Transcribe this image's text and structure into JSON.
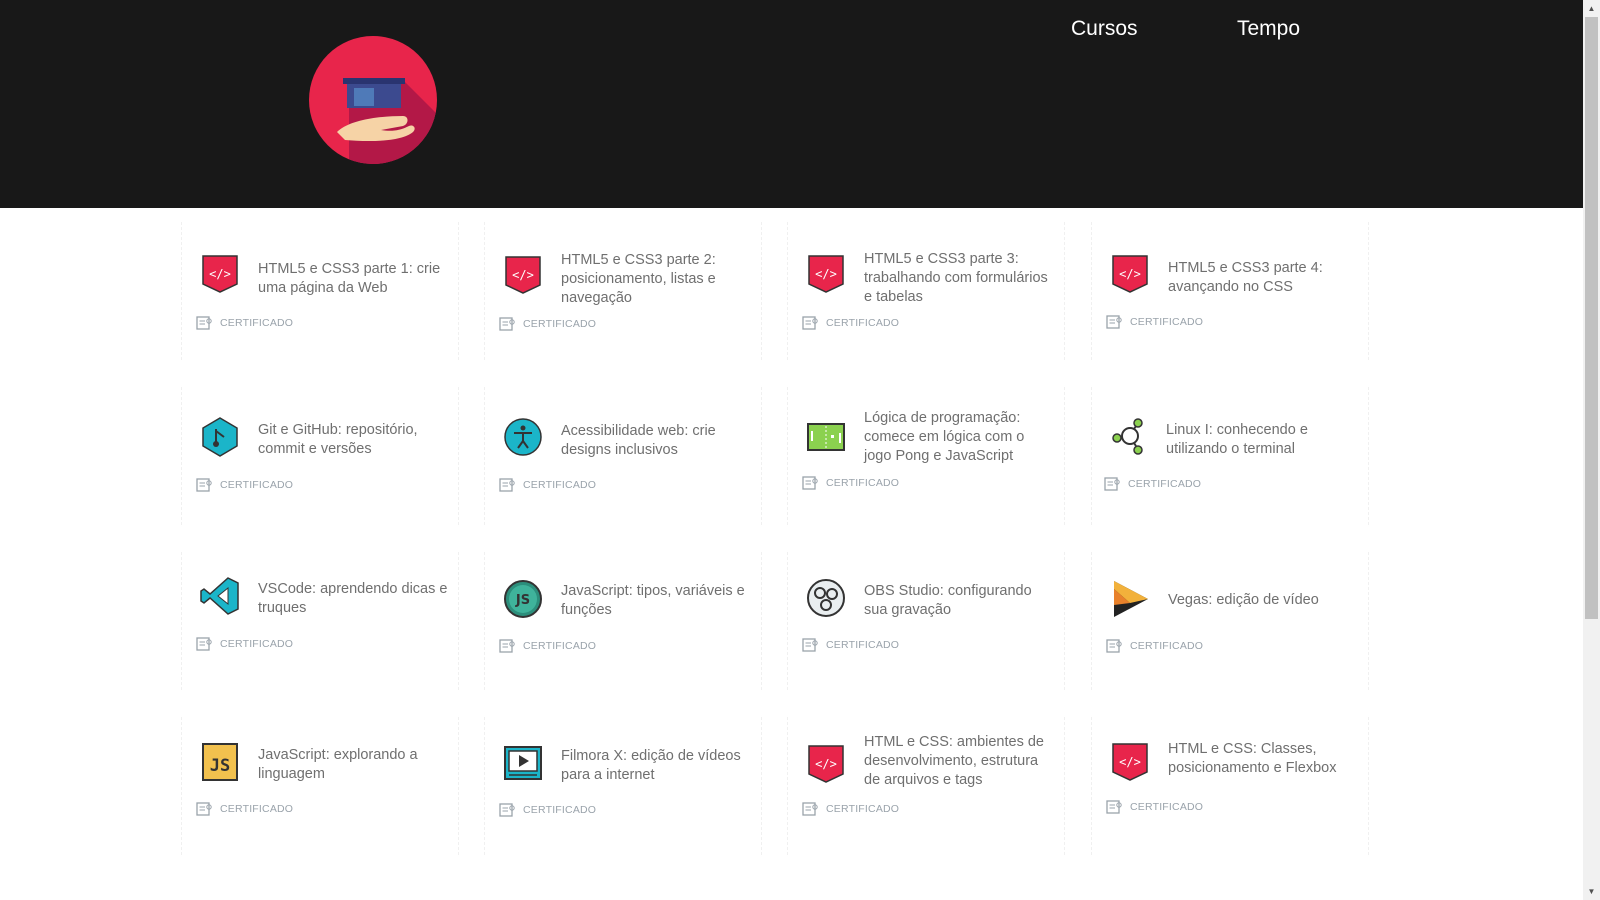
{
  "nav": {
    "cursos": "Cursos",
    "tempo": "Tempo"
  },
  "colors": {
    "header_bg": "#181818",
    "logo_bg": "#e8254b",
    "html_icon": "#e8254b",
    "text": "#6f6f6f",
    "cert": "#9aa3ab"
  },
  "cert_label": "CERTIFICADO",
  "courses": [
    {
      "title": "HTML5 e CSS3 parte 1: crie uma página da Web",
      "icon": "html-icon"
    },
    {
      "title": "HTML5 e CSS3 parte 2: posicionamento, listas e navegação",
      "icon": "html-icon"
    },
    {
      "title": "HTML5 e CSS3 parte 3: trabalhando com formulários e tabelas",
      "icon": "html-icon"
    },
    {
      "title": "HTML5 e CSS3 parte 4: avançando no CSS",
      "icon": "html-icon"
    },
    {
      "title": "Git e GitHub: repositório, commit e versões",
      "icon": "git-icon"
    },
    {
      "title": "Acessibilidade web: crie designs inclusivos",
      "icon": "accessibility-icon"
    },
    {
      "title": "Lógica de programação: comece em lógica com o jogo Pong e JavaScript",
      "icon": "pong-icon"
    },
    {
      "title": "Linux I: conhecendo e utilizando o terminal",
      "icon": "linux-icon"
    },
    {
      "title": "VSCode: aprendendo dicas e truques",
      "icon": "vscode-icon"
    },
    {
      "title": "JavaScript: tipos, variáveis e funções",
      "icon": "js-circle-icon"
    },
    {
      "title": "OBS Studio: configurando sua gravação",
      "icon": "obs-icon"
    },
    {
      "title": "Vegas: edição de vídeo",
      "icon": "vegas-icon"
    },
    {
      "title": "JavaScript: explorando a linguagem",
      "icon": "js-square-icon"
    },
    {
      "title": "Filmora X: edição de vídeos para a internet",
      "icon": "filmora-icon"
    },
    {
      "title": "HTML e CSS: ambientes de desenvolvimento, estrutura de arquivos e tags",
      "icon": "html-icon"
    },
    {
      "title": "HTML e CSS: Classes, posicionamento e Flexbox",
      "icon": "html-icon"
    }
  ]
}
